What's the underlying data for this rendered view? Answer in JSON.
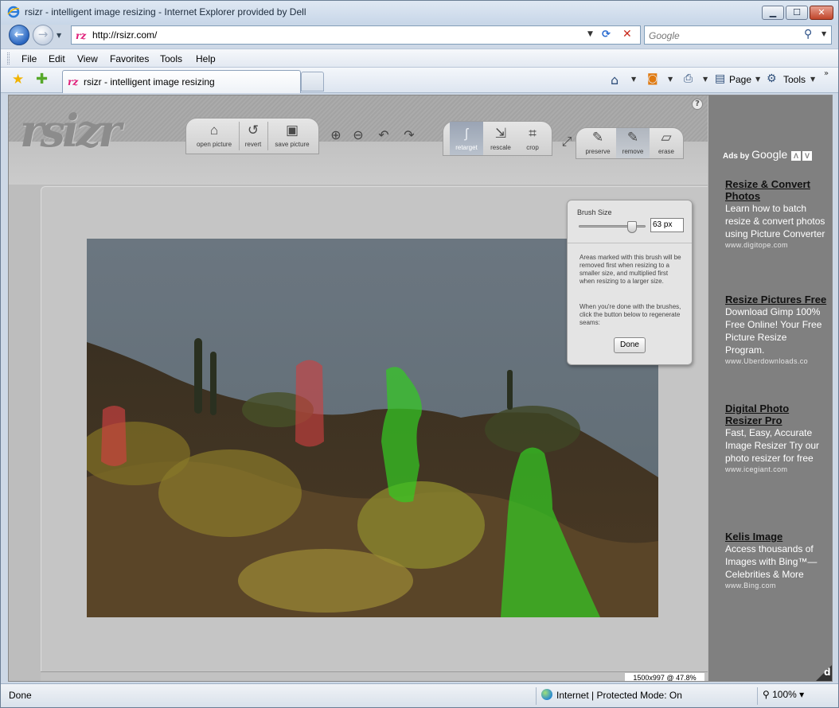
{
  "window": {
    "title": "rsizr - intelligent image resizing - Internet Explorer provided by Dell",
    "minimize": "▁",
    "maximize": "☐",
    "close": "✕"
  },
  "nav": {
    "address": "http://rsizr.com/",
    "search_placeholder": "Google"
  },
  "menu": {
    "items": [
      "File",
      "Edit",
      "View",
      "Favorites",
      "Tools",
      "Help"
    ]
  },
  "tabs": {
    "active_label": "rsizr - intelligent image resizing"
  },
  "command_bar": {
    "page_label": "Page",
    "tools_label": "Tools"
  },
  "app": {
    "logo": "rsizr",
    "toolbar": {
      "open": "open picture",
      "revert": "revert",
      "save": "save picture",
      "retarget": "retarget",
      "rescale": "rescale",
      "crop": "crop",
      "preserve": "preserve",
      "remove": "remove",
      "erase": "erase"
    },
    "brush_panel": {
      "title": "Brush Size",
      "size_value": "63 px",
      "slider_fraction": 0.8,
      "description": "Areas marked with this brush will be removed first when resizing to a smaller size, and multiplied first when resizing to a larger size.",
      "instructions": "When you're done with the brushes, click the button below to regenerate seams:",
      "done_label": "Done"
    },
    "image_info": "1500x997 @ 47.8%"
  },
  "ads": {
    "header_prefix": "Ads by",
    "header_brand": "Google",
    "items": [
      {
        "title": "Resize & Convert Photos",
        "body": "Learn how to batch resize & convert photos using Picture Converter",
        "url": "www.digitope.com"
      },
      {
        "title": "Resize Pictures Free",
        "body": "Download Gimp 100% Free Online! Your Free Picture Resize Program.",
        "url": "www.Uberdownloads.co"
      },
      {
        "title": "Digital Photo Resizer Pro",
        "body": "Fast, Easy, Accurate Image Resizer Try our photo resizer for free",
        "url": "www.icegiant.com"
      },
      {
        "title": "Kelis Image",
        "body": "Access thousands of Images with Bing™—Celebrities & More",
        "url": "www.Bing.com"
      }
    ]
  },
  "status": {
    "text": "Done",
    "zone": "Internet | Protected Mode: On",
    "zoom": "100%"
  },
  "colors": {
    "remove_brush": "#d04040",
    "preserve_brush": "#33cc22"
  }
}
